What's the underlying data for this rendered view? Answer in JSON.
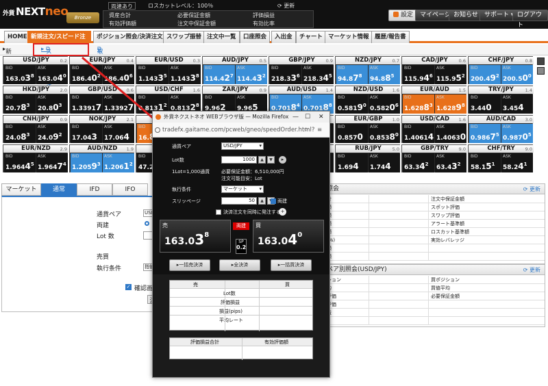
{
  "header": {
    "logo_prefix": "外貨",
    "logo_main": "NEXT",
    "logo_neo": "neo",
    "rank_label": "Bronze",
    "tags": [
      "両建あり",
      "ロスカットレベル：100％",
      "更新"
    ],
    "info_left": [
      "資産合計",
      "有効評価額"
    ],
    "info_mid": [
      "必要保証金額",
      "注文中保証金額"
    ],
    "info_right": [
      "評価損益",
      "有効比率"
    ],
    "buttons": [
      "設定",
      "マイページ",
      "お知らせ",
      "サポート",
      "ログアウト"
    ]
  },
  "nav": {
    "tabs": [
      "HOME",
      "新規注文/スピード注文",
      "ポジション照会/決済注文",
      "スワップ振替",
      "注文中一覧",
      "口座照会",
      "入出金",
      "チャート",
      "マーケット情報",
      "履歴/報告書"
    ]
  },
  "subnav": {
    "items": [
      "新規注文",
      "スピード注文",
      "取引条件一覧"
    ]
  },
  "rates": [
    {
      "pair": "USD/JPY",
      "sp": "0.2",
      "bid": [
        "163.0",
        "3",
        "8"
      ],
      "ask": [
        "163.0",
        "4",
        "0"
      ],
      "bc": "n",
      "ac": "n"
    },
    {
      "pair": "EUR/JPY",
      "sp": "0.4",
      "bid": [
        "186.4",
        "0",
        "2"
      ],
      "ask": [
        "186.4",
        "0",
        "6"
      ],
      "bc": "n",
      "ac": "n"
    },
    {
      "pair": "EUR/USD",
      "sp": "0.3",
      "bid": [
        "1.143",
        "3",
        "5"
      ],
      "ask": [
        "1.143",
        "3",
        "8"
      ],
      "bc": "n",
      "ac": "n"
    },
    {
      "pair": "AUD/JPY",
      "sp": "0.5",
      "bid": [
        "114.4",
        "2",
        "7"
      ],
      "ask": [
        "114.4",
        "3",
        "2"
      ],
      "bc": "u",
      "ac": "u"
    },
    {
      "pair": "GBP/JPY",
      "sp": "0.9",
      "bid": [
        "218.3",
        "3",
        "6"
      ],
      "ask": [
        "218.3",
        "4",
        "5"
      ],
      "bc": "n",
      "ac": "n"
    },
    {
      "pair": "NZD/JPY",
      "sp": "0.7",
      "bid": [
        "94.8",
        "7",
        "8"
      ],
      "ask": [
        "94.8",
        "8",
        "5"
      ],
      "bc": "u",
      "ac": "u"
    },
    {
      "pair": "CAD/JPY",
      "sp": "0.6",
      "bid": [
        "115.9",
        "4",
        "6"
      ],
      "ask": [
        "115.9",
        "5",
        "2"
      ],
      "bc": "n",
      "ac": "n"
    },
    {
      "pair": "CHF/JPY",
      "sp": "0.8",
      "bid": [
        "200.4",
        "9",
        "2"
      ],
      "ask": [
        "200.5",
        "0",
        "0"
      ],
      "bc": "u",
      "ac": "u"
    },
    {
      "pair": "HKD/JPY",
      "sp": "2.0",
      "bid": [
        "20.7",
        "8",
        "3"
      ],
      "ask": [
        "20.8",
        "0",
        "3"
      ],
      "bc": "n",
      "ac": "n"
    },
    {
      "pair": "GBP/USD",
      "sp": "0.6",
      "bid": [
        "1.3391",
        "7",
        ""
      ],
      "ask": [
        "1.3392",
        "7",
        ""
      ],
      "bc": "n",
      "ac": "n"
    },
    {
      "pair": "USD/CHF",
      "sp": "1.6",
      "bid": [
        "0.813",
        "1",
        "2"
      ],
      "ask": [
        "0.813",
        "2",
        "8"
      ],
      "bc": "n",
      "ac": "n"
    },
    {
      "pair": "ZAR/JPY",
      "sp": "0.9",
      "bid": [
        "9.96",
        "2",
        ""
      ],
      "ask": [
        "9.96",
        "5",
        ""
      ],
      "bc": "n",
      "ac": "n"
    },
    {
      "pair": "AUD/USD",
      "sp": "1.4",
      "bid": [
        "0.701",
        "8",
        "4"
      ],
      "ask": [
        "0.701",
        "8",
        "8"
      ],
      "bc": "u",
      "ac": "u"
    },
    {
      "pair": "NZD/USD",
      "sp": "1.6",
      "bid": [
        "0.581",
        "9",
        "0"
      ],
      "ask": [
        "0.582",
        "0",
        "6"
      ],
      "bc": "n",
      "ac": "n"
    },
    {
      "pair": "EUR/AUD",
      "sp": "1.5",
      "bid": [
        "1.628",
        "8",
        "3"
      ],
      "ask": [
        "1.628",
        "9",
        "8"
      ],
      "bc": "d",
      "ac": "d"
    },
    {
      "pair": "TRY/JPY",
      "sp": "1.4",
      "bid": [
        "3.44",
        "0",
        ""
      ],
      "ask": [
        "3.45",
        "4",
        ""
      ],
      "bc": "n",
      "ac": "n"
    },
    {
      "pair": "CNH/JPY",
      "sp": "0.9",
      "bid": [
        "24.0",
        "8",
        "3"
      ],
      "ask": [
        "24.0",
        "9",
        "2"
      ],
      "bc": "n",
      "ac": "n"
    },
    {
      "pair": "NOK/JPY",
      "sp": "2.1",
      "bid": [
        "17.04",
        "3",
        ""
      ],
      "ask": [
        "17.06",
        "4",
        ""
      ],
      "bc": "n",
      "ac": "n"
    },
    {
      "pair": "",
      "sp": "",
      "bid": [
        "16.",
        "8",
        ""
      ],
      "ask": [
        "",
        "",
        ""
      ],
      "bc": "d",
      "ac": "n"
    },
    {
      "pair": "",
      "sp": "",
      "bid": [
        "",
        "",
        ""
      ],
      "ask": [
        "",
        "",
        ""
      ],
      "bc": "n",
      "ac": "n"
    },
    {
      "pair": "",
      "sp": "",
      "bid": [
        "",
        "",
        ""
      ],
      "ask": [
        "",
        "",
        ""
      ],
      "bc": "n",
      "ac": "n"
    },
    {
      "pair": "EUR/GBP",
      "sp": "1.0",
      "bid": [
        "0.857",
        "0",
        ""
      ],
      "ask": [
        "0.853",
        "8",
        "0"
      ],
      "bc": "n",
      "ac": "n"
    },
    {
      "pair": "USD/CAD",
      "sp": "1.6",
      "bid": [
        "1.4061",
        "4",
        ""
      ],
      "ask": [
        "1.4063",
        "0",
        ""
      ],
      "bc": "n",
      "ac": "n"
    },
    {
      "pair": "AUD/CAD",
      "sp": "3.0",
      "bid": [
        "0.986",
        "7",
        "5"
      ],
      "ask": [
        "0.987",
        "0",
        "5"
      ],
      "bc": "u",
      "ac": "u"
    },
    {
      "pair": "EUR/NZD",
      "sp": "2.9",
      "bid": [
        "1.964",
        "4",
        "5"
      ],
      "ask": [
        "1.964",
        "7",
        "4"
      ],
      "bc": "n",
      "ac": "n"
    },
    {
      "pair": "AUD/NZD",
      "sp": "1.9",
      "bid": [
        "1.205",
        "9",
        "3"
      ],
      "ask": [
        "1.206",
        "1",
        "2"
      ],
      "bc": "u",
      "ac": "u"
    },
    {
      "pair": "",
      "sp": "",
      "bid": [
        "47.2",
        "",
        ""
      ],
      "ask": [
        "",
        "",
        ""
      ],
      "bc": "n",
      "ac": "n"
    },
    {
      "pair": "",
      "sp": "",
      "bid": [
        "",
        "",
        ""
      ],
      "ask": [
        "",
        "",
        ""
      ],
      "bc": "n",
      "ac": "n"
    },
    {
      "pair": "",
      "sp": "",
      "bid": [
        "",
        "",
        ""
      ],
      "ask": [
        "",
        "",
        ""
      ],
      "bc": "n",
      "ac": "n"
    },
    {
      "pair": "RUB/JPY",
      "sp": "5.0",
      "bid": [
        "1.69",
        "4",
        ""
      ],
      "ask": [
        "1.74",
        "4",
        ""
      ],
      "bc": "n",
      "ac": "n"
    },
    {
      "pair": "GBP/TRY",
      "sp": "9.0",
      "bid": [
        "63.3",
        "4",
        "2"
      ],
      "ask": [
        "63.4",
        "3",
        "2"
      ],
      "bc": "n",
      "ac": "n"
    },
    {
      "pair": "CHF/TRY",
      "sp": "9.0",
      "bid": [
        "58.1",
        "5",
        "1"
      ],
      "ask": [
        "58.2",
        "4",
        "1"
      ],
      "bc": "n",
      "ac": "n"
    }
  ],
  "lower": {
    "tabs": [
      "マーケット",
      "通常",
      "IFD",
      "IFO"
    ],
    "form_labels": [
      "通貨ペア",
      "両建",
      "Lot 数",
      "売買",
      "執行条件"
    ],
    "form_values": [
      "USD",
      "",
      "",
      "",
      "指値"
    ],
    "confirm_label": "確認画",
    "confirm_btn": "注"
  },
  "rpanel": {
    "title": "照会",
    "update": "更新",
    "left": [
      "計",
      "額",
      "額",
      "額",
      "額",
      "(%)",
      "額",
      "額"
    ],
    "right": [
      "注文中保証金額",
      "スポット評価",
      "スワップ評価",
      "アラート基準額",
      "ロスカット基準額",
      "実効レバレッジ"
    ]
  },
  "rpanel2": {
    "title": "ペア別照会(USD/JPY)",
    "update": "更新",
    "left": [
      "ション",
      "均",
      "評価",
      "評価",
      "益"
    ],
    "right": [
      "買ポジション",
      "買値平均",
      "必要保証金額"
    ]
  },
  "popup": {
    "title": "外貨ネクストネオ WEBブラウザ版 — Mozilla Firefox",
    "url": "tradefx.gaitame.com/pcweb/gneo/speedOrder.html?",
    "pair_label": "通貨ペア",
    "pair_value": "USD/JPY",
    "lot_label": "Lot数",
    "lot_value": "1000",
    "note1": "1Lot=1,000通貨",
    "note2": "必要保証金額：6,510,000円",
    "note3": "注文可能目安：Lot",
    "exec_label": "執行条件",
    "exec_value": "マーケット",
    "slip_label": "スリッページ",
    "slip_value": "50",
    "both_label": "両建",
    "settle_label": "決済注文を同時に発注する",
    "sell_label": "売",
    "buy_label": "買",
    "hedge_tag": "両建",
    "sell_price": [
      "163.0",
      "3",
      "8"
    ],
    "buy_price": [
      "163.0",
      "4",
      "0"
    ],
    "sp_label": "SP",
    "sp_value": "0.2",
    "btn_sell_all": "一括売決済",
    "btn_all": "全決済",
    "btn_buy_all": "一括買決済",
    "table_sell": "売",
    "table_buy": "買",
    "table_rows": [
      "Lot数",
      "評価損益",
      "損益(pips)",
      "平均レート"
    ],
    "table2": [
      "評価損益合計",
      "有効評価額"
    ]
  }
}
